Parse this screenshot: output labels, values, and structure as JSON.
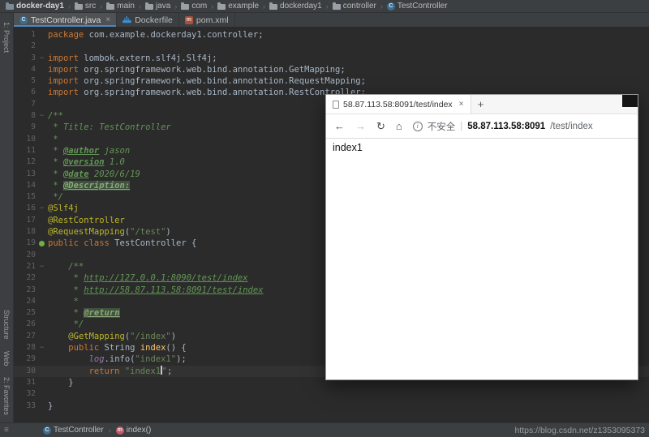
{
  "theme": {
    "editor_bg": "#2b2b2b",
    "panel_bg": "#3c3f41",
    "keyword": "#cc7832",
    "string": "#6a8759",
    "annotation": "#bbb529",
    "javadoc": "#629755",
    "plain_text": "#a9b7c6",
    "line_number": "#606366",
    "active_tab_underline": "#4a88c7",
    "bean_icon_green": "#6db33f"
  },
  "nav_bar": {
    "separator": "›",
    "items": [
      {
        "label": "docker-day1",
        "icon": "project"
      },
      {
        "label": "src",
        "icon": "folder"
      },
      {
        "label": "main",
        "icon": "folder"
      },
      {
        "label": "java",
        "icon": "folder"
      },
      {
        "label": "com",
        "icon": "folder"
      },
      {
        "label": "example",
        "icon": "folder"
      },
      {
        "label": "dockerday1",
        "icon": "folder"
      },
      {
        "label": "controller",
        "icon": "folder"
      },
      {
        "label": "TestController",
        "icon": "class"
      }
    ]
  },
  "editor_tabs": {
    "tabs": [
      {
        "label": "TestController.java",
        "icon": "class",
        "active": true,
        "close": "×"
      },
      {
        "label": "Dockerfile",
        "icon": "docker",
        "active": false
      },
      {
        "label": "pom.xml",
        "icon": "maven",
        "active": false
      }
    ]
  },
  "tool_stripe": {
    "top": [
      "1: Project"
    ],
    "bottom": [
      "Structure",
      "Web",
      "2: Favorites"
    ]
  },
  "editor": {
    "lines": [
      {
        "n": 1,
        "seg": [
          [
            "k",
            "package"
          ],
          [
            "p",
            " com.example.dockerday1.controller;"
          ]
        ]
      },
      {
        "n": 2,
        "seg": []
      },
      {
        "n": 3,
        "fold": "−",
        "seg": [
          [
            "k",
            "import"
          ],
          [
            "p",
            " lombok.extern.slf4j.Slf4j;"
          ]
        ]
      },
      {
        "n": 4,
        "seg": [
          [
            "k",
            "import"
          ],
          [
            "p",
            " org.springframework.web.bind.annotation.GetMapping;"
          ]
        ]
      },
      {
        "n": 5,
        "seg": [
          [
            "k",
            "import"
          ],
          [
            "p",
            " org.springframework.web.bind.annotation.RequestMapping;"
          ]
        ]
      },
      {
        "n": 6,
        "seg": [
          [
            "k",
            "import"
          ],
          [
            "p",
            " org.springframework.web.bind.annotation.RestController;"
          ]
        ]
      },
      {
        "n": 7,
        "seg": []
      },
      {
        "n": 8,
        "fold": "−",
        "seg": [
          [
            "jd",
            "/**"
          ]
        ]
      },
      {
        "n": 9,
        "seg": [
          [
            "jd",
            " * Title: TestController"
          ]
        ]
      },
      {
        "n": 10,
        "seg": [
          [
            "jd",
            " *"
          ]
        ]
      },
      {
        "n": 11,
        "seg": [
          [
            "jd",
            " * "
          ],
          [
            "jdt",
            "@author"
          ],
          [
            "jd",
            " jason"
          ]
        ]
      },
      {
        "n": 12,
        "seg": [
          [
            "jd",
            " * "
          ],
          [
            "jdt",
            "@version"
          ],
          [
            "jd",
            " 1.0"
          ]
        ]
      },
      {
        "n": 13,
        "seg": [
          [
            "jd",
            " * "
          ],
          [
            "jdt",
            "@date"
          ],
          [
            "jd",
            " 2020/6/19"
          ]
        ]
      },
      {
        "n": 14,
        "seg": [
          [
            "jd",
            " * "
          ],
          [
            "jdh",
            "@Description:"
          ]
        ]
      },
      {
        "n": 15,
        "seg": [
          [
            "jd",
            " */"
          ]
        ]
      },
      {
        "n": 16,
        "fold": "−",
        "seg": [
          [
            "a",
            "@Slf4j"
          ]
        ]
      },
      {
        "n": 17,
        "seg": [
          [
            "a",
            "@RestController"
          ]
        ]
      },
      {
        "n": 18,
        "seg": [
          [
            "a",
            "@RequestMapping"
          ],
          [
            "p",
            "("
          ],
          [
            "s",
            "\"/test\""
          ],
          [
            "p",
            ")"
          ]
        ]
      },
      {
        "n": 19,
        "icon": "bean",
        "seg": [
          [
            "k",
            "public class"
          ],
          [
            "p",
            " TestController {"
          ]
        ]
      },
      {
        "n": 20,
        "seg": []
      },
      {
        "n": 21,
        "fold": "−",
        "seg": [
          [
            "jd",
            "    /**"
          ]
        ]
      },
      {
        "n": 22,
        "seg": [
          [
            "jd",
            "     * "
          ],
          [
            "lk",
            "http://127.0.0.1:8090/test/index"
          ]
        ]
      },
      {
        "n": 23,
        "seg": [
          [
            "jd",
            "     * "
          ],
          [
            "lk",
            "http://58.87.113.58:8091/test/index"
          ]
        ]
      },
      {
        "n": 24,
        "seg": [
          [
            "jd",
            "     *"
          ]
        ]
      },
      {
        "n": 25,
        "seg": [
          [
            "jd",
            "     * "
          ],
          [
            "jdh",
            "@return"
          ]
        ]
      },
      {
        "n": 26,
        "seg": [
          [
            "jd",
            "     */"
          ]
        ]
      },
      {
        "n": 27,
        "seg": [
          [
            "p",
            "    "
          ],
          [
            "a",
            "@GetMapping"
          ],
          [
            "p",
            "("
          ],
          [
            "s",
            "\"/index\""
          ],
          [
            "p",
            ")"
          ]
        ]
      },
      {
        "n": 28,
        "fold": "−",
        "seg": [
          [
            "p",
            "    "
          ],
          [
            "k",
            "public"
          ],
          [
            "p",
            " String "
          ],
          [
            "m",
            "index"
          ],
          [
            "p",
            "() {"
          ]
        ]
      },
      {
        "n": 29,
        "seg": [
          [
            "p",
            "        "
          ],
          [
            "fl",
            "log"
          ],
          [
            "p",
            ".info("
          ],
          [
            "s",
            "\"index1\""
          ],
          [
            "p",
            ");"
          ]
        ]
      },
      {
        "n": 30,
        "cur": true,
        "seg": [
          [
            "p",
            "        "
          ],
          [
            "k",
            "return"
          ],
          [
            "p",
            " "
          ],
          [
            "s",
            "\"index1"
          ],
          [
            "cr",
            ""
          ],
          [
            "s",
            "\""
          ],
          [
            "p",
            ";"
          ]
        ]
      },
      {
        "n": 31,
        "seg": [
          [
            "p",
            "    }"
          ]
        ]
      },
      {
        "n": 32,
        "seg": []
      },
      {
        "n": 33,
        "seg": [
          [
            "p",
            "}"
          ]
        ]
      }
    ]
  },
  "status_bar": {
    "menu_icon": "≡",
    "separator": "›",
    "path": [
      {
        "label": "TestController",
        "icon": "class"
      },
      {
        "label": "index()",
        "icon": "method"
      }
    ]
  },
  "watermark": "https://blog.csdn.net/z1353095373",
  "browser": {
    "tab_title": "58.87.113.58:8091/test/index",
    "tab_close": "×",
    "new_tab": "+",
    "nav": {
      "back": "←",
      "forward": "→",
      "refresh": "↻",
      "home": "⌂"
    },
    "security_info": "i",
    "security_label": "不安全",
    "url_divider": "|",
    "url_host": "58.87.113.58:8091",
    "url_path": "/test/index",
    "page_text": "index1"
  }
}
